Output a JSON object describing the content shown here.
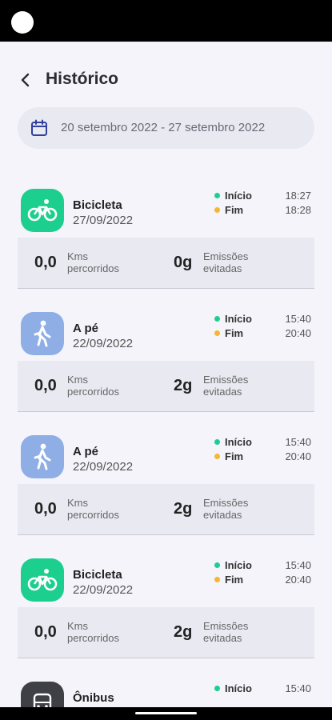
{
  "header": {
    "title": "Histórico"
  },
  "date_range": {
    "text": "20 setembro 2022 - 27 setembro 2022"
  },
  "trips": [
    {
      "mode": "Bicicleta",
      "date": "27/09/2022",
      "icon": "bike-icon",
      "start_label": "Início",
      "start_time": "18:27",
      "end_label": "Fim",
      "end_time": "18:28",
      "kms_value": "0,0",
      "kms_label_1": "Kms",
      "kms_label_2": "percorridos",
      "emissions_value": "0g",
      "emissions_label_1": "Emissões",
      "emissions_label_2": "evitadas"
    },
    {
      "mode": "A pé",
      "date": "22/09/2022",
      "icon": "walk-icon",
      "start_label": "Início",
      "start_time": "15:40",
      "end_label": "Fim",
      "end_time": "20:40",
      "kms_value": "0,0",
      "kms_label_1": "Kms",
      "kms_label_2": "percorridos",
      "emissions_value": "2g",
      "emissions_label_1": "Emissões",
      "emissions_label_2": "evitadas"
    },
    {
      "mode": "A pé",
      "date": "22/09/2022",
      "icon": "walk-icon",
      "start_label": "Início",
      "start_time": "15:40",
      "end_label": "Fim",
      "end_time": "20:40",
      "kms_value": "0,0",
      "kms_label_1": "Kms",
      "kms_label_2": "percorridos",
      "emissions_value": "2g",
      "emissions_label_1": "Emissões",
      "emissions_label_2": "evitadas"
    },
    {
      "mode": "Bicicleta",
      "date": "22/09/2022",
      "icon": "bike-icon",
      "start_label": "Início",
      "start_time": "15:40",
      "end_label": "Fim",
      "end_time": "20:40",
      "kms_value": "0,0",
      "kms_label_1": "Kms",
      "kms_label_2": "percorridos",
      "emissions_value": "2g",
      "emissions_label_1": "Emissões",
      "emissions_label_2": "evitadas"
    },
    {
      "mode": "Ônibus",
      "icon": "bus-icon",
      "start_label": "Início",
      "start_time": "15:40"
    }
  ],
  "colors": {
    "bike": "#1ccf8e",
    "walk": "#8eaee5",
    "bus": "#3f3f46",
    "start_dot": "#1ccf8e",
    "end_dot": "#f5b731"
  }
}
